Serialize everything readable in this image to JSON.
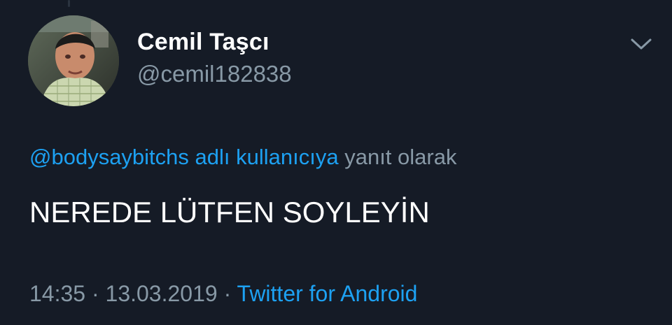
{
  "user": {
    "display_name": "Cemil Taşcı",
    "handle": "@cemil182838"
  },
  "reply": {
    "mention_text": "@bodysaybitchs adlı kullanıcıya",
    "suffix": " yanıt olarak"
  },
  "tweet": {
    "text": "NEREDE LÜTFEN SOYLEYİN"
  },
  "meta": {
    "time": "14:35",
    "separator1": " · ",
    "date": "13.03.2019",
    "separator2": " · ",
    "source": "Twitter for Android"
  },
  "colors": {
    "background": "#151b26",
    "primary_text": "#ffffff",
    "secondary_text": "#8899a6",
    "accent": "#1da1f2"
  },
  "icons": {
    "menu": "chevron-down-icon",
    "profile": "avatar"
  }
}
